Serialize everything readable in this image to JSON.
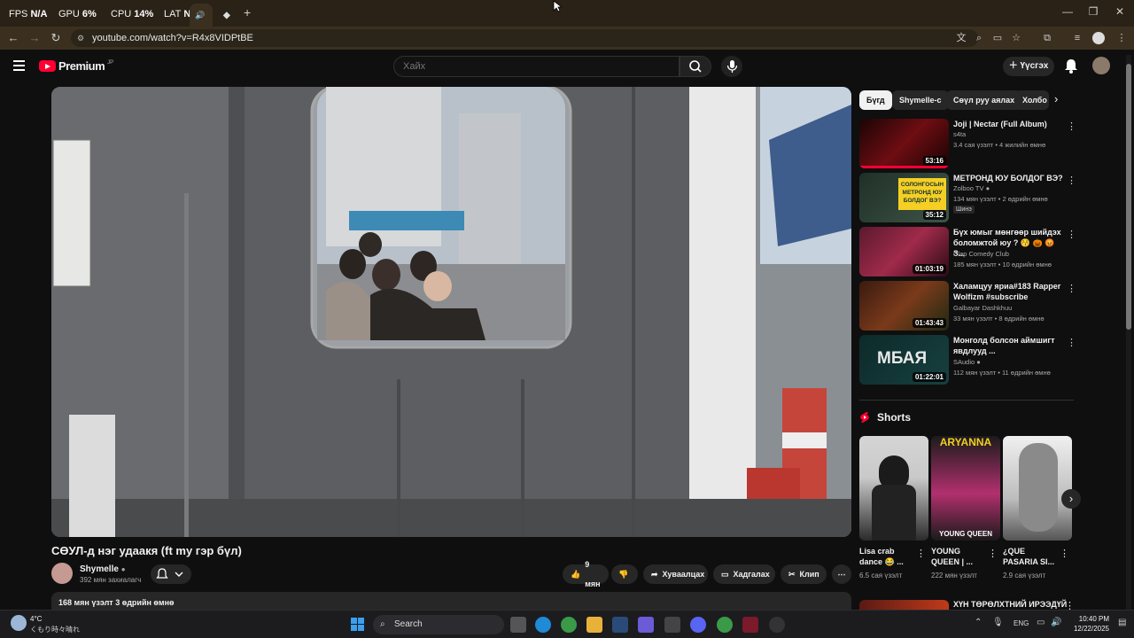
{
  "overlay": {
    "fps_label": "FPS",
    "fps_value": "N/A",
    "gpu_label": "GPU",
    "gpu_value": "6%",
    "cpu_label": "CPU",
    "cpu_value": "14%",
    "lat_label": "LAT",
    "lat_value": "N/A"
  },
  "browser": {
    "url": "youtube.com/watch?v=R4x8VIDPtBE",
    "new_tab": "+"
  },
  "header": {
    "brand": "Premium",
    "brand_sup": "JP",
    "search_placeholder": "Хайх",
    "create_label": "Үүсгэх"
  },
  "video": {
    "title": "СӨУЛ-д нэг удаакя (ft my гэр бүл)",
    "channel": "Shymelle",
    "subscribers": "392 мян захиалагч",
    "likes": "9 мян",
    "share": "Хуваалцах",
    "save": "Хадгалах",
    "clip": "Клип",
    "description": "168 мян үзэлт  3 өдрийн өмнө"
  },
  "chips": [
    "Бүгд",
    "Shymelle-с",
    "Сөүл руу аялах",
    "Холбо"
  ],
  "recommendations": [
    {
      "title": "Joji | Nectar (Full Album)",
      "channel": "s4ta",
      "meta": "3.4 сая үзэлт • 4 жилийн өмнө",
      "duration": "53:16",
      "verified": false,
      "new": ""
    },
    {
      "title": "МЕТРОНД ЮУ БОЛДОГ ВЭ?",
      "channel": "Zolboo TV",
      "meta": "134 мян үзэлт • 2 өдрийн өмнө",
      "duration": "35:12",
      "verified": true,
      "new": "Шинэ"
    },
    {
      "title": "Бүх юмыг мөнгөөр шийдэх боломжтой юу ? 😚 🎃 😡 З...",
      "channel": "Clap Comedy Club",
      "meta": "185 мян үзэлт • 10 өдрийн өмнө",
      "duration": "01:03:19",
      "verified": false,
      "new": ""
    },
    {
      "title": "Халамцуу яриа#183  Rapper Wolfizm  #subscribe",
      "channel": "Galbayar Dashkhuu",
      "meta": "33 мян үзэлт • 8 өдрийн өмнө",
      "duration": "01:43:43",
      "verified": false,
      "new": ""
    },
    {
      "title": "Монголд болсон аймшигт явдлууд ...",
      "channel": "SAudio",
      "meta": "112 мян үзэлт • 11 өдрийн өмнө",
      "duration": "01:22:01",
      "verified": true,
      "new": ""
    }
  ],
  "thumb_texts": {
    "t2": "СОЛОНГОСЫН МЕТРОНД ЮУ БОЛДОГ ВЭ?",
    "t5": "МБАЯ"
  },
  "shorts": {
    "heading": "Shorts",
    "items": [
      {
        "title": "Lisa crab dance 😂 ...",
        "views": "6.5 сая үзэлт",
        "overlay_top": "",
        "overlay_bottom": ""
      },
      {
        "title": "YOUNG QUEEN | ...",
        "views": "222 мян үзэлт",
        "overlay_top": "ARYANNA",
        "overlay_bottom": "YOUNG QUEEN"
      },
      {
        "title": "¿QUE PASARIA SI...",
        "views": "2.9 сая үзэлт",
        "overlay_top": "",
        "overlay_bottom": ""
      }
    ]
  },
  "next_section_title": "ХҮН ТӨРӨЛХТНИЙ ИРЭЭДҮЙ",
  "taskbar": {
    "weather_temp": "4°C",
    "weather_desc": "くもり時々晴れ",
    "search": "Search",
    "lang": "ENG",
    "time": "10:40 PM",
    "date": "12/22/2025"
  },
  "colors": {
    "accent": "#ff0033",
    "chrome": "#3b3020",
    "bg": "#0f0f0f"
  }
}
